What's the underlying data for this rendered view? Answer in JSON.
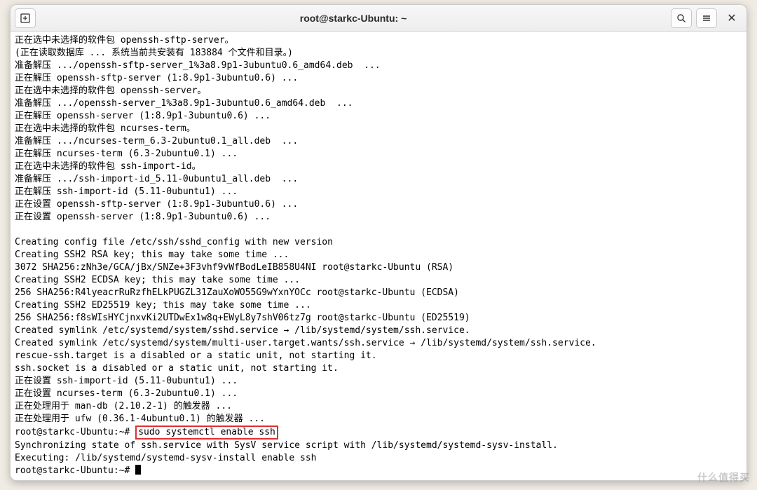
{
  "titlebar": {
    "title": "root@starkc-Ubuntu: ~"
  },
  "terminal": {
    "lines": [
      "正在选中未选择的软件包 openssh-sftp-server。",
      "(正在读取数据库 ... 系统当前共安装有 183884 个文件和目录。)",
      "准备解压 .../openssh-sftp-server_1%3a8.9p1-3ubuntu0.6_amd64.deb  ...",
      "正在解压 openssh-sftp-server (1:8.9p1-3ubuntu0.6) ...",
      "正在选中未选择的软件包 openssh-server。",
      "准备解压 .../openssh-server_1%3a8.9p1-3ubuntu0.6_amd64.deb  ...",
      "正在解压 openssh-server (1:8.9p1-3ubuntu0.6) ...",
      "正在选中未选择的软件包 ncurses-term。",
      "准备解压 .../ncurses-term_6.3-2ubuntu0.1_all.deb  ...",
      "正在解压 ncurses-term (6.3-2ubuntu0.1) ...",
      "正在选中未选择的软件包 ssh-import-id。",
      "准备解压 .../ssh-import-id_5.11-0ubuntu1_all.deb  ...",
      "正在解压 ssh-import-id (5.11-0ubuntu1) ...",
      "正在设置 openssh-sftp-server (1:8.9p1-3ubuntu0.6) ...",
      "正在设置 openssh-server (1:8.9p1-3ubuntu0.6) ...",
      "",
      "Creating config file /etc/ssh/sshd_config with new version",
      "Creating SSH2 RSA key; this may take some time ...",
      "3072 SHA256:zNh3e/GCA/jBx/SNZe+3F3vhf9vWfBodLeIB858U4NI root@starkc-Ubuntu (RSA)",
      "Creating SSH2 ECDSA key; this may take some time ...",
      "256 SHA256:R4lyeacrRuRzfhELkPUGZL31ZauXoWO55G9wYxnYOCc root@starkc-Ubuntu (ECDSA)",
      "Creating SSH2 ED25519 key; this may take some time ...",
      "256 SHA256:f8sWIsHYCjnxvKi2UTDwEx1w8q+EWyL8y7shV06tz7g root@starkc-Ubuntu (ED25519)",
      "Created symlink /etc/systemd/system/sshd.service → /lib/systemd/system/ssh.service.",
      "Created symlink /etc/systemd/system/multi-user.target.wants/ssh.service → /lib/systemd/system/ssh.service.",
      "rescue-ssh.target is a disabled or a static unit, not starting it.",
      "ssh.socket is a disabled or a static unit, not starting it.",
      "正在设置 ssh-import-id (5.11-0ubuntu1) ...",
      "正在设置 ncurses-term (6.3-2ubuntu0.1) ...",
      "正在处理用于 man-db (2.10.2-1) 的触发器 ...",
      "正在处理用于 ufw (0.36.1-4ubuntu0.1) 的触发器 ..."
    ],
    "prompt1_prefix": "root@starkc-Ubuntu:~# ",
    "prompt1_cmd": "sudo systemctl enable ssh",
    "after_lines": [
      "Synchronizing state of ssh.service with SysV service script with /lib/systemd/systemd-sysv-install.",
      "Executing: /lib/systemd/systemd-sysv-install enable ssh"
    ],
    "prompt2_prefix": "root@starkc-Ubuntu:~# "
  },
  "watermark": "什么值得买"
}
